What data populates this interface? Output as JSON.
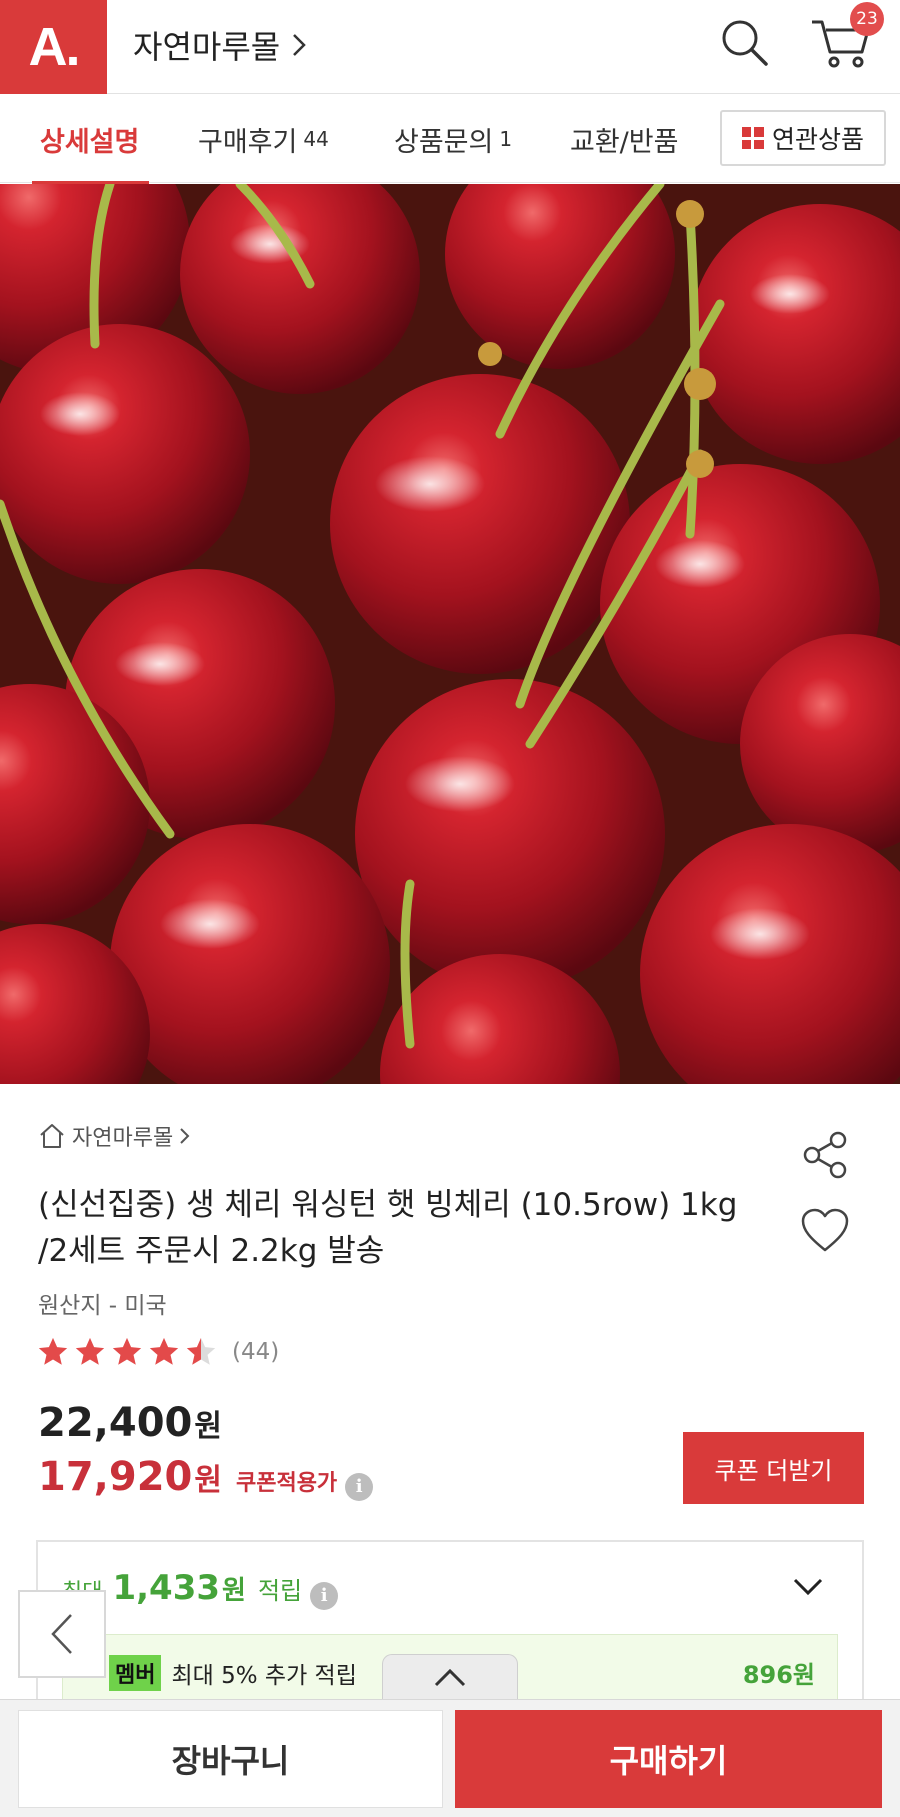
{
  "header": {
    "logo_text": "A.",
    "store_name": "자연마루몰",
    "cart_count": "23"
  },
  "tabs": [
    {
      "label": "상세설명",
      "count": ""
    },
    {
      "label": "구매후기",
      "count": "44"
    },
    {
      "label": "상품문의",
      "count": "1"
    },
    {
      "label": "교환/반품",
      "count": ""
    }
  ],
  "related_button": "연관상품",
  "product": {
    "breadcrumb": "자연마루몰",
    "title": "(신선집중) 생 체리 워싱턴 햇 빙체리 (10.5row) 1kg /2세트 주문시 2.2kg 발송",
    "origin": "원산지 - 미국",
    "rating": 4.5,
    "review_count": "(44)",
    "price": "22,400",
    "price_unit": "원",
    "coupon_price": "17,920",
    "coupon_label": "쿠폰적용가",
    "coupon_button": "쿠폰 더받기"
  },
  "points": {
    "prefix": "최대",
    "amount": "1,433",
    "unit": "원",
    "suffix": "적립",
    "member_badge": "멤버",
    "member_text": "최대 5% 추가 적립",
    "member_amount": "896원"
  },
  "bottom": {
    "cart_label": "장바구니",
    "buy_label": "구매하기"
  },
  "colors": {
    "brand": "#d93a3a",
    "points_green": "#45a33a"
  }
}
